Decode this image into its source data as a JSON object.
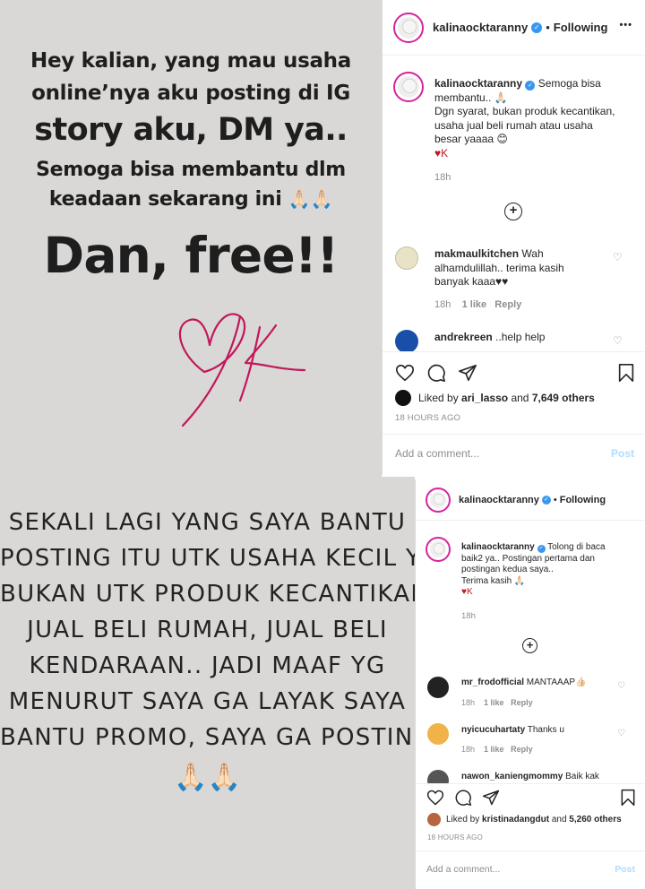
{
  "story1": {
    "lines": [
      "Hey kalian, yang mau usaha",
      "online’nya aku posting di IG",
      "story aku, DM ya..",
      "Semoga bisa membantu dlm",
      "keadaan sekarang ini",
      "Dan, free!!"
    ],
    "emoji": "🙏🏻🙏🏻",
    "signature_color": "#c2185b"
  },
  "story2": {
    "lines": [
      "Sekali lagi yang saya bantu",
      "posting itu utk usaha kecil ya..",
      "Bukan utk produk kecantikan,",
      "jual beli rumah, jual beli",
      "kendaraan.. Jadi maaf yg",
      "menurut saya ga layak saya",
      "bantu promo, saya ga posting..."
    ],
    "emoji": "🙏🏻🙏🏻"
  },
  "post1": {
    "username": "kalinaocktaranny",
    "following": "Following",
    "more": "•••",
    "caption": [
      "Semoga bisa",
      "membantu.. 🙏🏻",
      "Dgn syarat, bukan produk kecantikan,",
      "usaha jual beli rumah atau usaha",
      "besar yaaaa 😊",
      "♥K"
    ],
    "caption_time": "18h",
    "comments": [
      {
        "user": "makmaulkitchen",
        "text": [
          "Wah",
          "alhamdulillah.. terima kasih",
          "banyak kaaa♥♥"
        ],
        "time": "18h",
        "likes": "1 like",
        "reply": "Reply"
      },
      {
        "user": "andrekreen",
        "text": [
          "..help help"
        ],
        "time": "",
        "likes": "",
        "reply": ""
      }
    ],
    "liked_by_prefix": "Liked by",
    "liked_by_user": "ari_lasso",
    "liked_by_and": "and",
    "liked_by_others": "7,649 others",
    "ago": "18 HOURS AGO",
    "add_comment": "Add a comment...",
    "post_label": "Post"
  },
  "post2": {
    "username": "kalinaocktaranny",
    "following": "Following",
    "more": "•••",
    "caption": [
      "Tolong di baca",
      "baik2 ya.. Postingan pertama dan",
      "postingan kedua saya..",
      "Terima kasih 🙏🏻",
      "♥K"
    ],
    "caption_time": "18h",
    "comments": [
      {
        "user": "mr_frodofficial",
        "text": [
          "MANTAAAP👍🏻"
        ],
        "time": "18h",
        "likes": "1 like",
        "reply": "Reply"
      },
      {
        "user": "nyicucuhartaty",
        "text": [
          "Thanks u"
        ],
        "time": "18h",
        "likes": "1 like",
        "reply": "Reply"
      },
      {
        "user": "nawon_kaniengmommy",
        "text": [
          "Baik kak"
        ],
        "time": "",
        "likes": "",
        "reply": ""
      }
    ],
    "liked_by_prefix": "Liked by",
    "liked_by_user": "kristinadangdut",
    "liked_by_and": "and",
    "liked_by_others": "5,260 others",
    "ago": "18 HOURS AGO",
    "add_comment": "Add a comment...",
    "post_label": "Post"
  },
  "colors": {
    "story_bg": "#d9d8d6",
    "link_blue": "#3897f0",
    "post_btn": "#b3dbff",
    "heart_red": "#c0171f"
  }
}
